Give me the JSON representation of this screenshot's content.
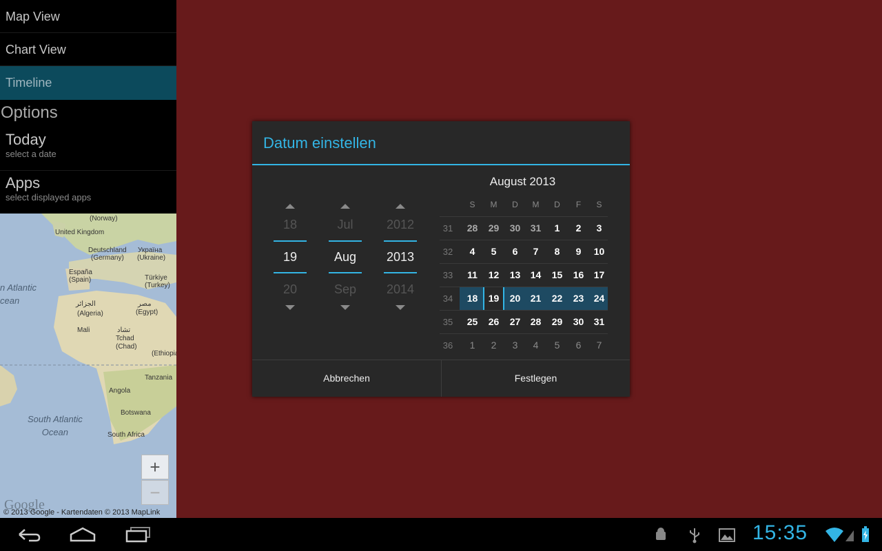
{
  "sidebar": {
    "nav": [
      "Map View",
      "Chart View",
      "Timeline"
    ],
    "options_title": "Options",
    "options": [
      {
        "title": "Today",
        "subtitle": "select a date"
      },
      {
        "title": "Apps",
        "subtitle": "select displayed apps"
      }
    ]
  },
  "map": {
    "labels": [
      "(Norway)",
      "United Kingdom",
      "Deutschland",
      "(Germany)",
      "Україна",
      "(Ukraine)",
      "España",
      "(Spain)",
      "Türkiye",
      "(Turkey)",
      "الجزائر",
      "(Algeria)",
      "مصر",
      "(Egypt)",
      "Mali",
      "تشاد",
      "Tchad",
      "(Chad)",
      "(Ethiopia",
      "Tanzania",
      "Angola",
      "Botswana",
      "South Africa"
    ],
    "ocean_north": [
      "n Atlantic",
      "cean"
    ],
    "ocean_south": [
      "South Atlantic",
      "Ocean"
    ],
    "zoom_in": "+",
    "zoom_out": "−",
    "logo": "Google",
    "copyright": "© 2013 Google - Kartendaten © 2013 MapLink"
  },
  "dialog": {
    "title": "Datum einstellen",
    "spinners": {
      "day": {
        "prev": "18",
        "current": "19",
        "next": "20"
      },
      "month": {
        "prev": "Jul",
        "current": "Aug",
        "next": "Sep"
      },
      "year": {
        "prev": "2012",
        "current": "2013",
        "next": "2014"
      }
    },
    "calendar": {
      "month_label": "August 2013",
      "weekdays": [
        "S",
        "M",
        "D",
        "M",
        "D",
        "F",
        "S"
      ],
      "weeks": [
        {
          "week": "31",
          "days": [
            "28",
            "29",
            "30",
            "31",
            "1",
            "2",
            "3"
          ]
        },
        {
          "week": "32",
          "days": [
            "4",
            "5",
            "6",
            "7",
            "8",
            "9",
            "10"
          ]
        },
        {
          "week": "33",
          "days": [
            "11",
            "12",
            "13",
            "14",
            "15",
            "16",
            "17"
          ]
        },
        {
          "week": "34",
          "days": [
            "18",
            "19",
            "20",
            "21",
            "22",
            "23",
            "24"
          ]
        },
        {
          "week": "35",
          "days": [
            "25",
            "26",
            "27",
            "28",
            "29",
            "30",
            "31"
          ]
        },
        {
          "week": "36",
          "days": [
            "1",
            "2",
            "3",
            "4",
            "5",
            "6",
            "7"
          ]
        }
      ],
      "selected_day": "19"
    },
    "buttons": {
      "cancel": "Abbrechen",
      "ok": "Festlegen"
    }
  },
  "status": {
    "time": "15:35",
    "accent": "#33b5e5"
  }
}
